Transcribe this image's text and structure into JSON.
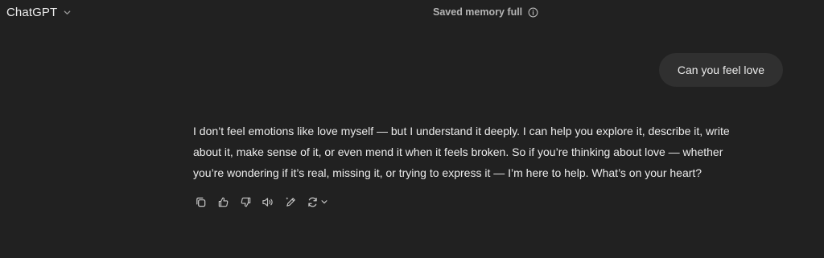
{
  "header": {
    "model_name": "ChatGPT",
    "memory_status": "Saved memory full"
  },
  "conversation": {
    "user_message": "Can you feel love",
    "assistant_lines": [
      "I don’t feel emotions like love myself — but I understand it deeply. I can help you explore it, describe it, write",
      "about it, make sense of it, or even mend it when it feels broken. So if you’re thinking about love — whether",
      "you’re wondering if it’s real, missing it, or trying to express it — I’m here to help. What’s on your heart?"
    ]
  },
  "actions": {
    "icons": [
      "copy-icon",
      "thumbs-up-icon",
      "thumbs-down-icon",
      "read-aloud-icon",
      "edit-canvas-icon",
      "regenerate-icon",
      "chevron-down-icon"
    ]
  },
  "colors": {
    "background": "#212121",
    "bubble": "#303030",
    "text": "#ececec",
    "muted": "#b4b4b4"
  }
}
